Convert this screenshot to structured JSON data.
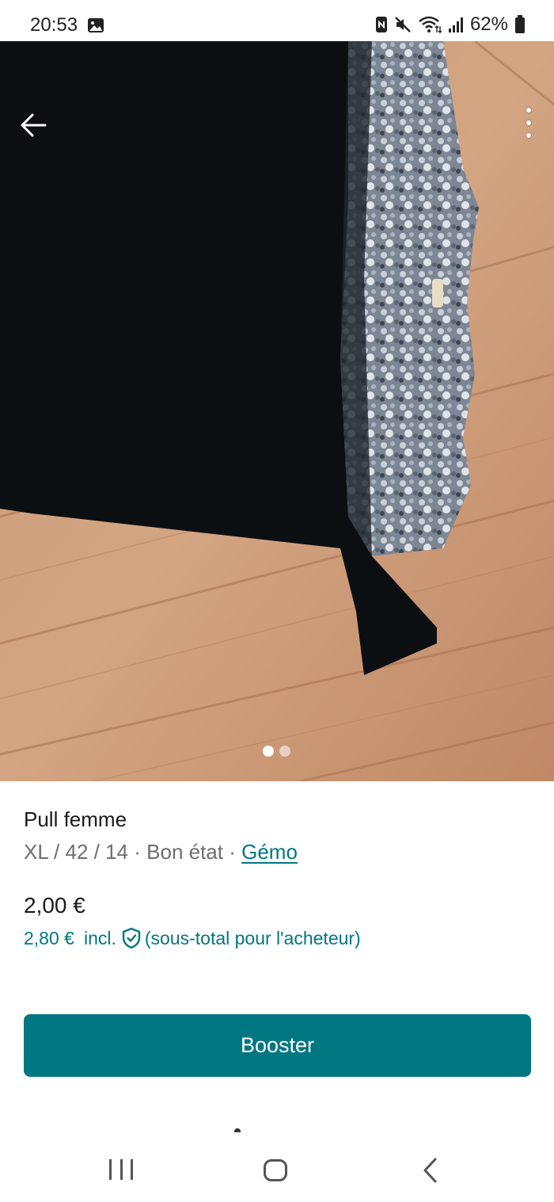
{
  "status_bar": {
    "time": "20:53",
    "battery": "62%",
    "icons": [
      "gallery-icon",
      "nfc-icon",
      "mute-icon",
      "wifi-icon",
      "signal-icon",
      "battery-icon"
    ]
  },
  "photo": {
    "pages": 2,
    "current_page": 1,
    "icons": [
      "back-arrow-icon",
      "more-vert-icon"
    ]
  },
  "item": {
    "title": "Pull femme",
    "size": "XL / 42 / 14",
    "sep1": " · ",
    "condition": "Bon état",
    "sep2": " · ",
    "brand": "Gémo",
    "price": "2,00 €",
    "buyer_price": "2,80 €",
    "incl": "incl.",
    "buyer_note": "(sous-total pour l'acheteur)"
  },
  "actions": {
    "boost_label": "Booster"
  },
  "colors": {
    "accent": "#007782",
    "button": "#017782"
  },
  "nav": {
    "icons": [
      "recent-apps-icon",
      "home-icon",
      "back-icon"
    ]
  }
}
